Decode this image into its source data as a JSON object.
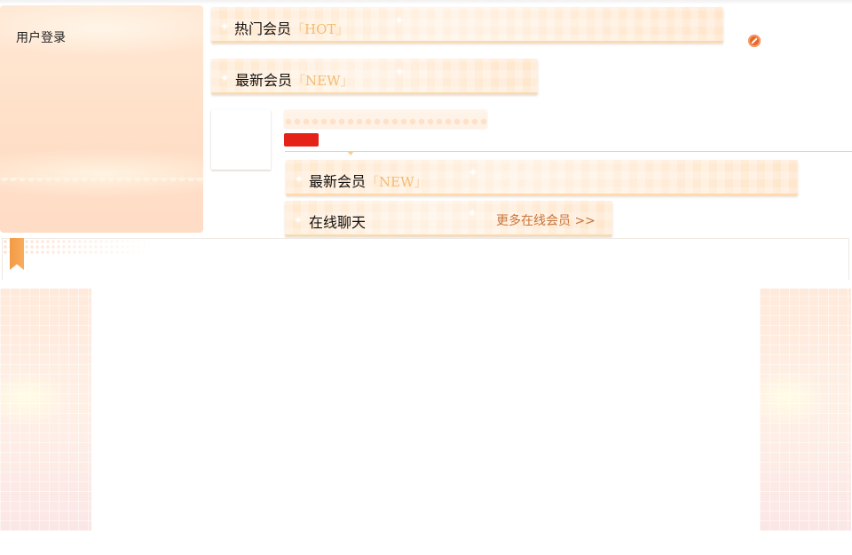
{
  "login": {
    "title": "用户登录"
  },
  "hot": {
    "label": "热门会员",
    "tag_open": "「",
    "tag": "HOT",
    "tag_close": "」"
  },
  "new_top": {
    "label": "最新会员",
    "tag_open": "「",
    "tag": "NEW",
    "tag_close": "」"
  },
  "new_mid": {
    "label": "最新会员",
    "tag_open": "「",
    "tag": "NEW",
    "tag_close": "」"
  },
  "chat": {
    "label": "在线聊天",
    "more": "更多在线会员 >>"
  },
  "icons": {
    "block": "block-icon",
    "bookmark": "bookmark-icon",
    "sparkle": "sparkle-icon"
  },
  "colors": {
    "accent": "#f2bd71",
    "link": "#c8743b",
    "badge": "#e42218",
    "panel": "#ffdfc7",
    "divider": "#f4cf8f"
  }
}
